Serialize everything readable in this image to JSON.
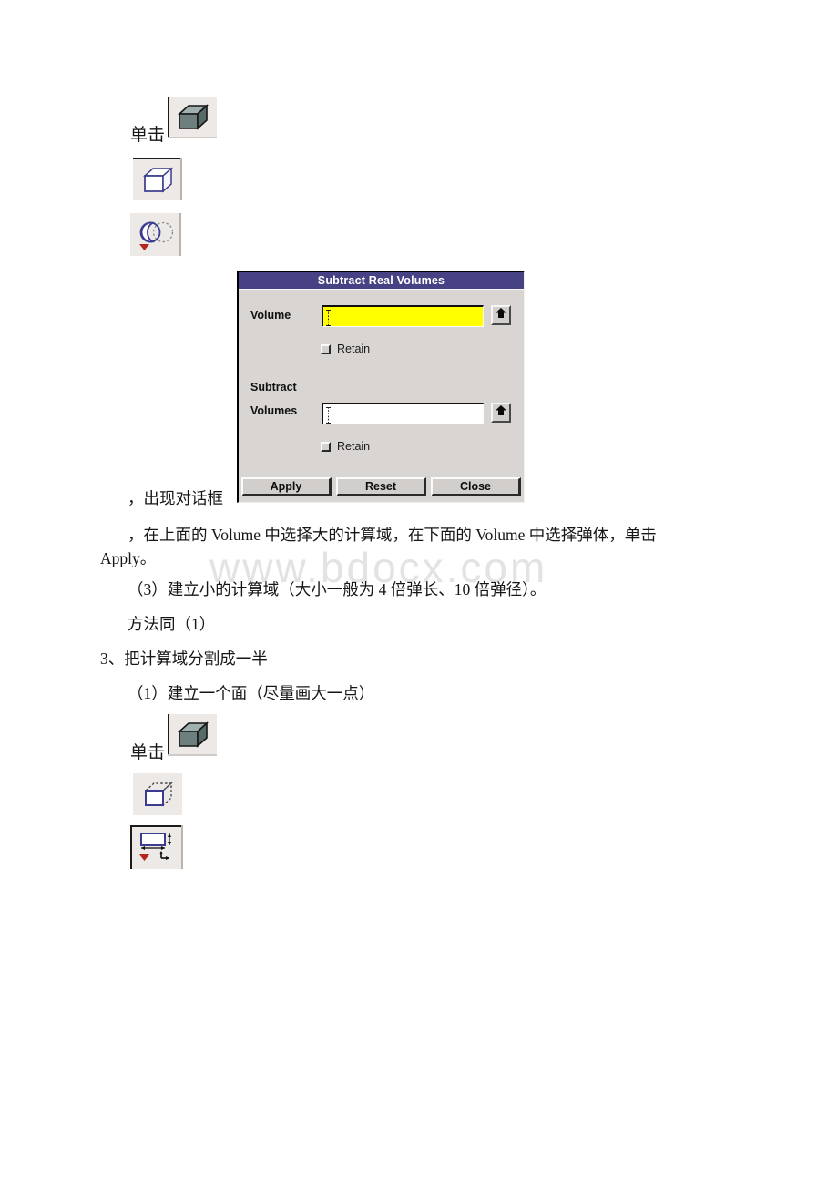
{
  "page": {
    "watermark": "www.bdocx.com"
  },
  "toolbar_top": {
    "click_label_1": "单击",
    "buttons": [
      {
        "icon": "solid-cube-icon",
        "tooltip": "Volumes"
      },
      {
        "icon": "wireframe-cube-icon",
        "tooltip": "Block"
      },
      {
        "icon": "boolean-subtract-icon",
        "tooltip": "Subtract"
      }
    ]
  },
  "toolbar_bottom": {
    "click_label_2": "单击",
    "buttons": [
      {
        "icon": "solid-cube-icon",
        "tooltip": "Volumes"
      },
      {
        "icon": "create-area-icon",
        "tooltip": "Areas"
      },
      {
        "icon": "rectangle-dimensions-icon",
        "tooltip": "Rectangle by Dimensions"
      }
    ]
  },
  "dialog": {
    "title": "Subtract Real Volumes",
    "volume_label": "Volume",
    "volume_value": "",
    "volume_retain_label": "Retain",
    "volume_retain_checked": false,
    "subtract_label_line1": "Subtract",
    "subtract_label_line2": "Volumes",
    "subtract_value": "",
    "subtract_retain_label": "Retain",
    "subtract_retain_checked": false,
    "pick_button_label": "▲",
    "buttons": {
      "apply": "Apply",
      "reset": "Reset",
      "close": "Close"
    },
    "colors": {
      "titlebar": "#474283",
      "face": "#d9d5d2",
      "active_field": "#ffff00"
    }
  },
  "body_text": {
    "line_dialog_caption": "，出现对话框",
    "line_instruction": "，在上面的 Volume 中选择大的计算域，在下面的 Volume 中选择弹体，单击",
    "line_instruction_cont": "Apply。",
    "line_step3": "（3）建立小的计算域（大小一般为 4 倍弹长、10 倍弹径）。",
    "line_method_same": "方法同（1）",
    "line_section3": "3、把计算域分割成一半",
    "line_step3_1": "（1）建立一个面（尽量画大一点）"
  }
}
